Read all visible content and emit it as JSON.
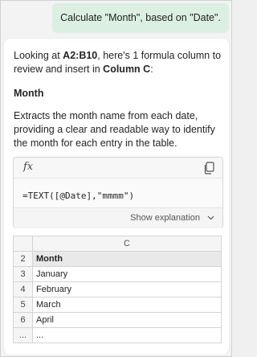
{
  "user_message": "Calculate \"Month\", based on \"Date\".",
  "response": {
    "intro_prefix": "Looking at ",
    "range": "A2:B10",
    "intro_middle": ", here's 1 formula column to review and insert in ",
    "column": "Column C",
    "intro_suffix": ":",
    "section_title": "Month",
    "description": "Extracts the month name from each date, providing a clear and readable way to identify the month for each entry in the table.",
    "formula": {
      "fx_symbol": "fx",
      "text": "=TEXT([@Date],\"mmmm\")",
      "show_explanation": "Show explanation"
    },
    "preview_table": {
      "column_header": "C",
      "rows": [
        {
          "num": "2",
          "value": "Month"
        },
        {
          "num": "3",
          "value": "January"
        },
        {
          "num": "4",
          "value": "February"
        },
        {
          "num": "5",
          "value": "March"
        },
        {
          "num": "6",
          "value": "April"
        },
        {
          "num": "...",
          "value": "..."
        }
      ]
    }
  },
  "colors": {
    "user_bubble": "#dcefe3",
    "header_row": "#e9e9e9"
  },
  "icons": {
    "copy": "copy-icon",
    "chevron": "chevron-down-icon"
  }
}
